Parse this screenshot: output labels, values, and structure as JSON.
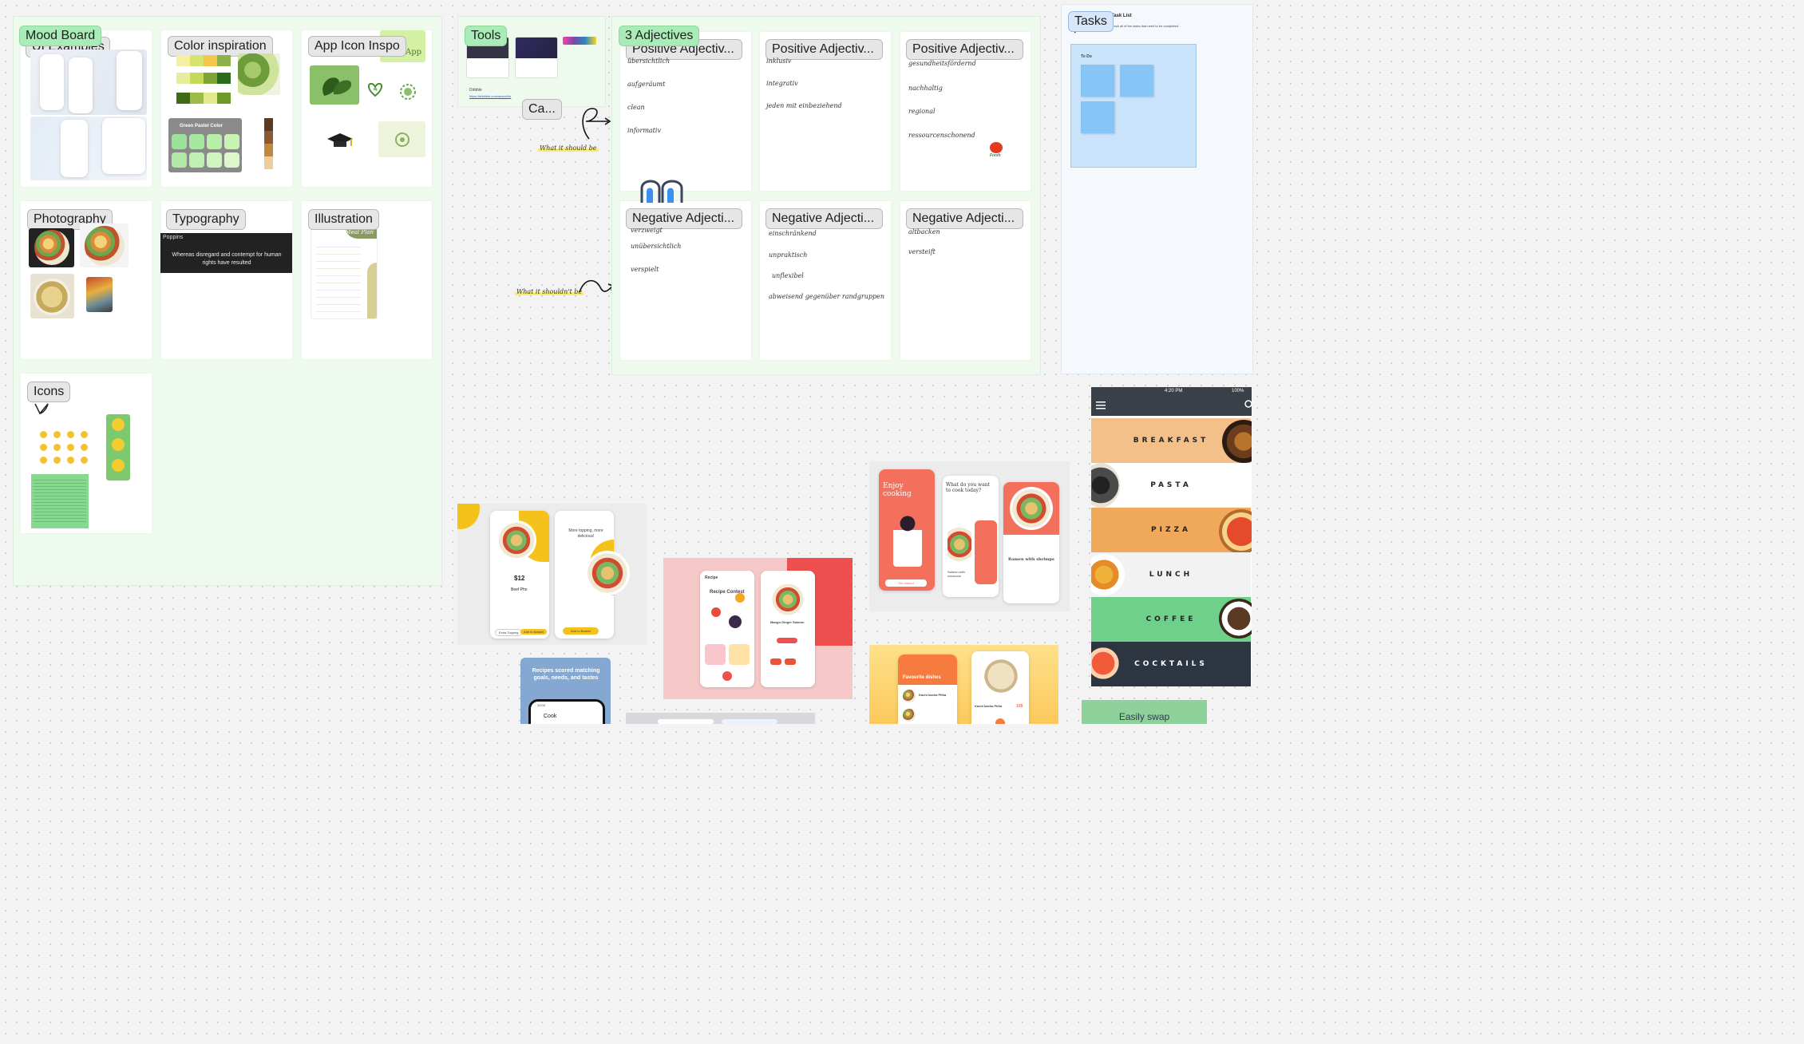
{
  "sections": {
    "mood_board": {
      "label": "Mood Board"
    },
    "tools": {
      "label": "Tools",
      "dribble": "Dribble",
      "dribble_link": "https://dribbble.com/search/le",
      "sub_label": "Ca...",
      "note": "What it should be"
    },
    "adjectives": {
      "label": "3 Adjectives",
      "note_neg": "What it shouldn't be"
    },
    "tasks": {
      "label": "Tasks",
      "list_title": "Task List",
      "list_desc": "Track all of the tasks that need to be completed.",
      "todo": "To Do"
    }
  },
  "cards": {
    "examples": {
      "label": "UI Examples"
    },
    "color": {
      "label": "Color inspiration",
      "palette_title": "Green Pastel Color"
    },
    "app_icon": {
      "label": "App Icon Inspo",
      "app_text": "App"
    },
    "photography": {
      "label": "Photography"
    },
    "typography": {
      "label": "Typography",
      "font_name": "Poppins",
      "sample": "Whereas disregard and contempt for human rights have resulted"
    },
    "illustration": {
      "label": "Illustration",
      "header": "Meal Plan"
    },
    "icons": {
      "label": "Icons"
    }
  },
  "positives": [
    {
      "label": "Positive Adjectiv...",
      "words": [
        "übersichtlich",
        "aufgeräumt",
        "clean",
        "informativ"
      ]
    },
    {
      "label": "Positive Adjectiv...",
      "words": [
        "inklusiv",
        "integrativ",
        "jeden mit einbeziehend"
      ]
    },
    {
      "label": "Positive Adjectiv...",
      "words": [
        "gesundheitsfördernd",
        "nachhaltig",
        "regional",
        "ressourcenschonend"
      ],
      "sticker": "Fresh"
    }
  ],
  "negatives": [
    {
      "label": "Negative Adjecti...",
      "words": [
        "verzweigt",
        "unübersichtlich",
        "verspielt"
      ]
    },
    {
      "label": "Negative Adjecti...",
      "words": [
        "einschränkend",
        "unpraktisch",
        "unflexibel",
        "abweisend gegenüber randgruppen"
      ]
    },
    {
      "label": "Negative Adjecti...",
      "words": [
        "altbacken",
        "versteift"
      ]
    }
  ],
  "recipes": {
    "price": "$12",
    "dish": "Beef Pho",
    "topping_title": "More topping, more delicious!",
    "btn_topping": "Extra Topping",
    "btn_add": "Add to Basket",
    "enjoy": "Enjoy cooking",
    "get_started": "Get started",
    "what_cook": "What do you want to cook today?",
    "salmon": "Salmon with couscous",
    "ramen": "Ramen with shrimps",
    "recipe": "Recipe",
    "contest": "Recipe Contest",
    "mango": "Mango Ginger Salmon",
    "favourite": "Favourite dishes",
    "kachi": "Kachi kacha Pitha",
    "kachi_price": "10$",
    "recipes_scored": "Recipes scored matching goals, needs, and tastes",
    "cook": "Cook",
    "phone_time": "10:00",
    "easily_swap": "Easily swap"
  },
  "menu": {
    "time": "4:20 PM",
    "battery": "100%",
    "rows": [
      {
        "label": "BREAKFAST",
        "bg": "#f4c08a"
      },
      {
        "label": "PASTA",
        "bg": "#ffffff"
      },
      {
        "label": "PIZZA",
        "bg": "#f0a95a"
      },
      {
        "label": "LUNCH",
        "bg": "#f2f2f2"
      },
      {
        "label": "COFFEE",
        "bg": "#6fd08b"
      },
      {
        "label": "COCKTAILS",
        "bg": "#2d3640"
      }
    ]
  }
}
